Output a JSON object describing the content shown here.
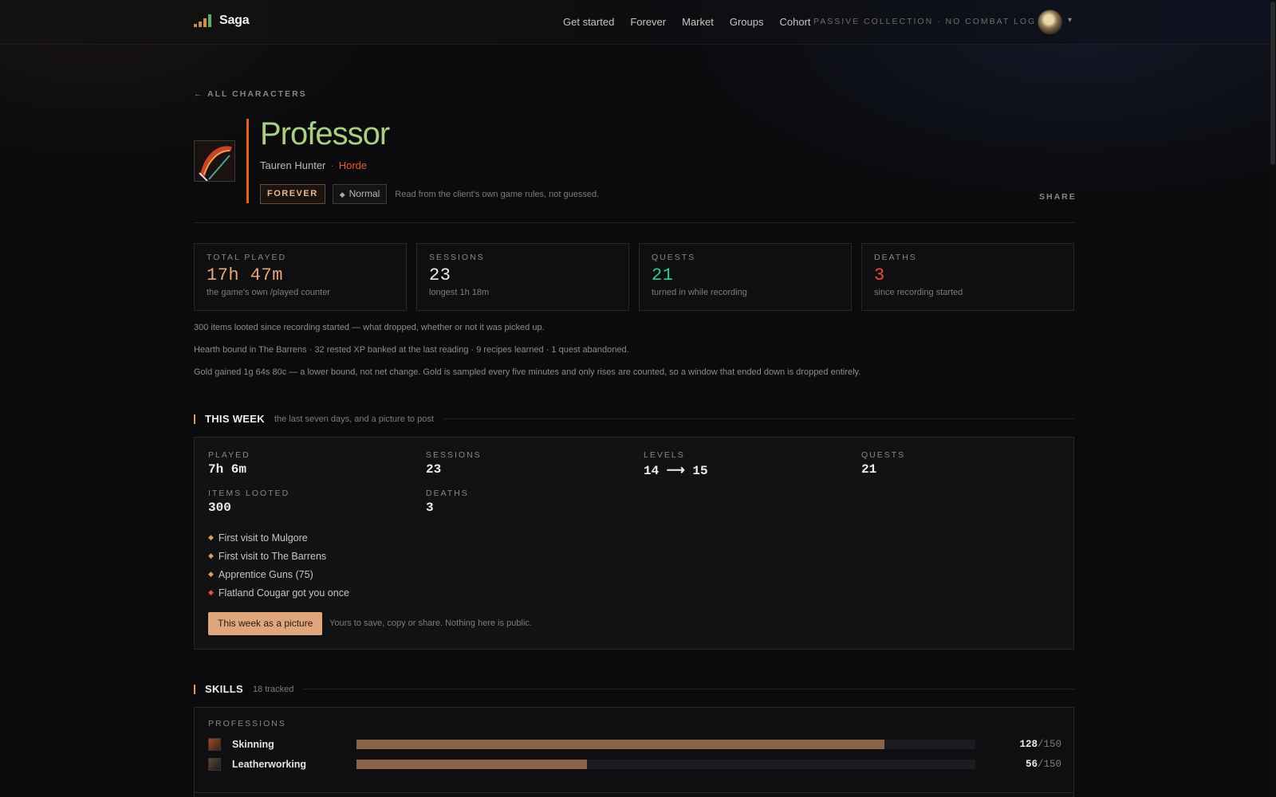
{
  "nav": {
    "brand": "Saga",
    "links": [
      "Get started",
      "Forever",
      "Market",
      "Groups",
      "Cohort"
    ],
    "passive_text": "PASSIVE COLLECTION · NO COMBAT LOG",
    "caret": "▾"
  },
  "back_link": "← ALL CHARACTERS",
  "character": {
    "name": "Professor",
    "race_class": "Tauren Hunter",
    "separator": "·",
    "faction": "Horde",
    "badge_mode": "FOREVER",
    "badge_difficulty": "Normal",
    "badge_diamond": "◆",
    "rules_note": "Read from the client's own game rules, not guessed.",
    "share": "SHARE"
  },
  "stats": [
    {
      "label": "TOTAL PLAYED",
      "value": "17h 47m",
      "note": "the game's own /played counter",
      "color": "#e8a77a"
    },
    {
      "label": "SESSIONS",
      "value": "23",
      "note": "longest 1h 18m",
      "color": "#f2efe9"
    },
    {
      "label": "QUESTS",
      "value": "21",
      "note": "turned in while recording",
      "color": "#2fcf8f"
    },
    {
      "label": "DEATHS",
      "value": "3",
      "note": "since recording started",
      "color": "#ef4a3c"
    }
  ],
  "info_lines": [
    "300 items looted since recording started — what dropped, whether or not it was picked up.",
    "Hearth bound in The Barrens · 32 rested XP banked at the last reading · 9 recipes learned · 1 quest abandoned.",
    "Gold gained 1g 64s 80c — a lower bound, not net change. Gold is sampled every five minutes and only rises are counted, so a window that ended down is dropped entirely."
  ],
  "this_week": {
    "title": "THIS WEEK",
    "subtitle": "the last seven days, and a picture to post",
    "stats": {
      "played": {
        "label": "PLAYED",
        "value": "7h 6m"
      },
      "sessions": {
        "label": "SESSIONS",
        "value": "23"
      },
      "levels": {
        "label": "LEVELS",
        "value": "14 ⟶ 15"
      },
      "quests": {
        "label": "QUESTS",
        "value": "21"
      },
      "items": {
        "label": "ITEMS LOOTED",
        "value": "300"
      },
      "deaths": {
        "label": "DEATHS",
        "value": "3"
      }
    },
    "milestones": [
      {
        "text": "First visit to Mulgore",
        "color": "#e09a5f"
      },
      {
        "text": "First visit to The Barrens",
        "color": "#e09a5f"
      },
      {
        "text": "Apprentice Guns (75)",
        "color": "#e09a5f"
      },
      {
        "text": "Flatland Cougar got you once",
        "color": "#ef4a4a"
      }
    ],
    "button": "This week as a picture",
    "button_note": "Yours to save, copy or share. Nothing here is public."
  },
  "skills": {
    "title": "SKILLS",
    "subtitle": "18 tracked",
    "group_label": "PROFESSIONS",
    "items": [
      {
        "name": "Skinning",
        "value": "128",
        "max": "/150",
        "fraction": 0.853,
        "icon": "skinning-icon"
      },
      {
        "name": "Leatherworking",
        "value": "56",
        "max": "/150",
        "fraction": 0.373,
        "icon": "leatherworking-icon"
      }
    ]
  }
}
